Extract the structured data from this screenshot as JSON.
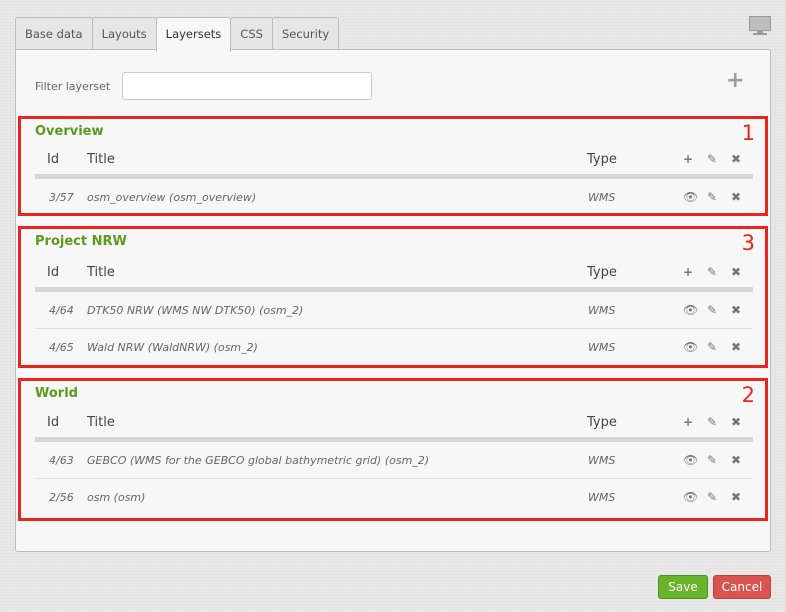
{
  "tabs": [
    {
      "label": "Base data",
      "active": false
    },
    {
      "label": "Layouts",
      "active": false
    },
    {
      "label": "Layersets",
      "active": true
    },
    {
      "label": "CSS",
      "active": false
    },
    {
      "label": "Security",
      "active": false
    }
  ],
  "toolbar": {
    "monitor_icon": "monitor-icon",
    "add_icon": "plus-icon",
    "add_glyph": "+"
  },
  "filter": {
    "label": "Filter layerset",
    "value": "",
    "placeholder": ""
  },
  "headers": {
    "id": "Id",
    "title": "Title",
    "type": "Type"
  },
  "glyphs": {
    "add": "+",
    "eye": "👁",
    "edit": "✎",
    "delete": "✖"
  },
  "sections": [
    {
      "name": "Overview",
      "marker": "1",
      "rows": [
        {
          "id": "3/57",
          "title": "osm_overview (osm_overview)",
          "type": "WMS"
        }
      ]
    },
    {
      "name": "Project NRW",
      "marker": "3",
      "rows": [
        {
          "id": "4/64",
          "title": "DTK50 NRW (WMS NW DTK50) (osm_2)",
          "type": "WMS"
        },
        {
          "id": "4/65",
          "title": "Wald NRW (WaldNRW) (osm_2)",
          "type": "WMS"
        }
      ]
    },
    {
      "name": "World",
      "marker": "2",
      "rows": [
        {
          "id": "4/63",
          "title": "GEBCO (WMS for the GEBCO global bathymetric grid) (osm_2)",
          "type": "WMS"
        },
        {
          "id": "2/56",
          "title": "osm (osm)",
          "type": "WMS"
        }
      ]
    }
  ],
  "colors": {
    "section_title": "#5a9a1c",
    "annotation": "#e8261f",
    "save": "#6ab42c",
    "cancel": "#d9534f"
  },
  "buttons": {
    "save": "Save",
    "cancel": "Cancel"
  }
}
